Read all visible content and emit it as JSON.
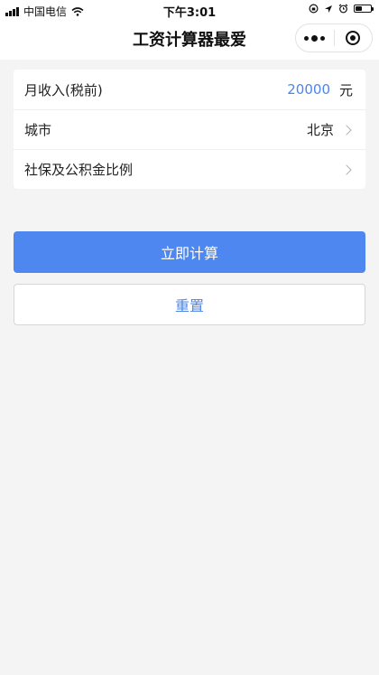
{
  "status_bar": {
    "carrier": "中国电信",
    "time": "下午3:01",
    "battery_level": 0.45
  },
  "nav": {
    "title": "工资计算器最爱"
  },
  "form": {
    "income": {
      "label": "月收入(税前)",
      "value": "20000",
      "unit": "元"
    },
    "city": {
      "label": "城市",
      "value": "北京"
    },
    "ratio": {
      "label": "社保及公积金比例"
    }
  },
  "actions": {
    "calculate_label": "立即计算",
    "reset_label": "重置"
  },
  "colors": {
    "primary": "#4e87ef",
    "accent_text": "#4a86e8",
    "background": "#f4f4f4"
  }
}
